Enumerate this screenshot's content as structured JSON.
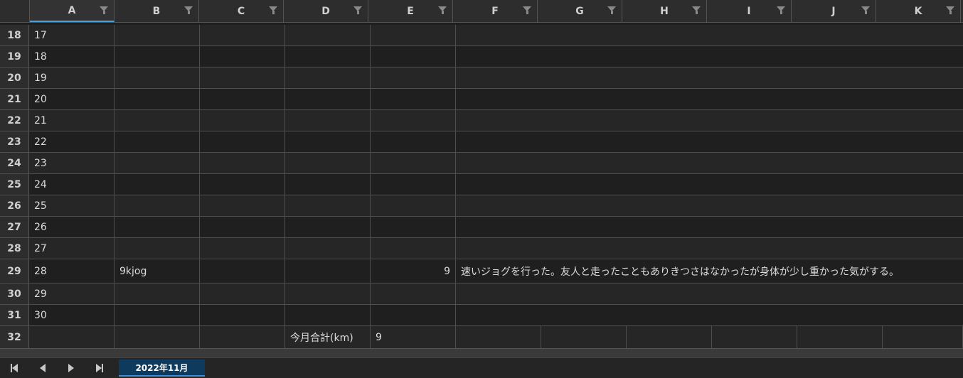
{
  "columns": [
    "A",
    "B",
    "C",
    "D",
    "E",
    "F",
    "G",
    "H",
    "I",
    "J",
    "K"
  ],
  "rows": [
    {
      "num": "18",
      "a": "17",
      "b": "",
      "e": "",
      "note": ""
    },
    {
      "num": "19",
      "a": "18",
      "b": "",
      "e": "",
      "note": ""
    },
    {
      "num": "20",
      "a": "19",
      "b": "",
      "e": "",
      "note": ""
    },
    {
      "num": "21",
      "a": "20",
      "b": "",
      "e": "",
      "note": ""
    },
    {
      "num": "22",
      "a": "21",
      "b": "",
      "e": "",
      "note": ""
    },
    {
      "num": "23",
      "a": "22",
      "b": "",
      "e": "",
      "note": ""
    },
    {
      "num": "24",
      "a": "23",
      "b": "",
      "e": "",
      "note": ""
    },
    {
      "num": "25",
      "a": "24",
      "b": "",
      "e": "",
      "note": ""
    },
    {
      "num": "26",
      "a": "25",
      "b": "",
      "e": "",
      "note": ""
    },
    {
      "num": "27",
      "a": "26",
      "b": "",
      "e": "",
      "note": ""
    },
    {
      "num": "28",
      "a": "27",
      "b": "",
      "e": "",
      "note": ""
    },
    {
      "num": "29",
      "a": "28",
      "b": "9kjog",
      "e": "9",
      "note": "速いジョグを行った。友人と走ったこともありきつさはなかったが身体が少し重かった気がする。"
    },
    {
      "num": "30",
      "a": "29",
      "b": "",
      "e": "",
      "note": ""
    },
    {
      "num": "31",
      "a": "30",
      "b": "",
      "e": "",
      "note": ""
    }
  ],
  "total_row": {
    "num": "32",
    "label": "今月合計(km)",
    "value": "9"
  },
  "sheet_tab": "2022年11月"
}
